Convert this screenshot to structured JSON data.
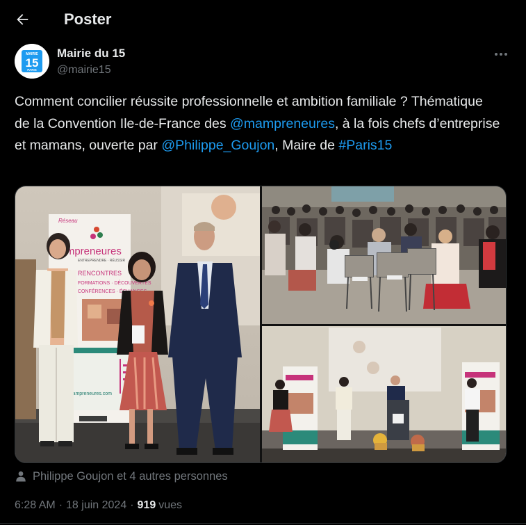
{
  "header": {
    "title": "Poster"
  },
  "author": {
    "name": "Mairie du 15",
    "handle": "@mairie15",
    "avatar": {
      "top": "MAIRIE",
      "number": "15",
      "bottom": "PARIS"
    }
  },
  "tweet": {
    "parts": [
      "Comment concilier réussite professionnelle et ambition familiale ? Thématique de la Convention Ile-de-France des ",
      "@mampreneures",
      ", à la fois chefs d’entreprise et mamans, ouverte par ",
      "@Philippe_Goujon",
      ", Maire de ",
      "#Paris15"
    ]
  },
  "media": {
    "banner_left": {
      "small": "Réseau",
      "brand": "mampreneures",
      "tagline": "ENTREPRENDRE · RÉUSSIR",
      "lines": [
        "RENCONTRES",
        "FORMATIONS · DÉCOUVERTES",
        "CONFÉRENCES · ÉCHANGES"
      ],
      "url": "www.mampreneures.com"
    }
  },
  "tagged": {
    "text": "Philippe Goujon et 4 autres personnes"
  },
  "meta": {
    "time": "6:28 AM",
    "date": "18 juin 2024",
    "views": "919",
    "views_label": "vues"
  },
  "colors": {
    "accent": "#1d9bf0",
    "background": "#000000",
    "muted": "#71767b"
  }
}
